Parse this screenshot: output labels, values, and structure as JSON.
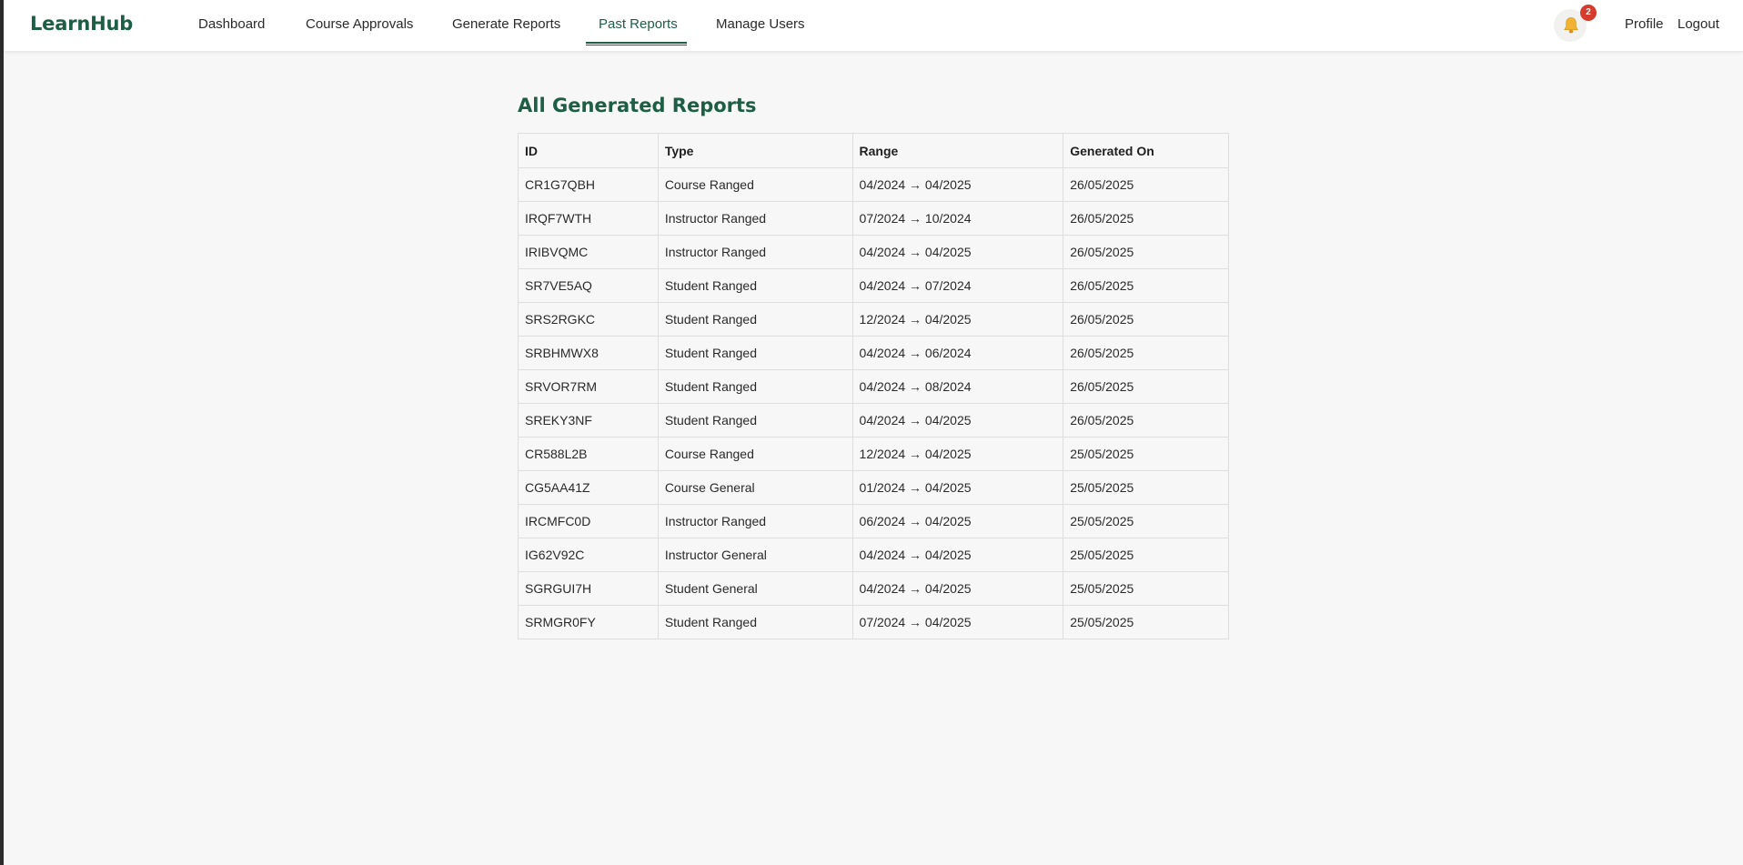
{
  "app": {
    "brand": "LearnHub"
  },
  "nav": {
    "items": [
      {
        "label": "Dashboard"
      },
      {
        "label": "Course Approvals"
      },
      {
        "label": "Generate Reports"
      },
      {
        "label": "Past Reports",
        "active": true
      },
      {
        "label": "Manage Users"
      }
    ],
    "notifications": {
      "icon": "bell-icon",
      "count": "2"
    },
    "profile_label": "Profile",
    "logout_label": "Logout"
  },
  "colors": {
    "brand": "#1e5e45",
    "badge": "#d63c2e",
    "background": "#f7f7f7"
  },
  "page": {
    "title": "All Generated Reports"
  },
  "table": {
    "headers": [
      "ID",
      "Type",
      "Range",
      "Generated On"
    ],
    "rows": [
      [
        "CR1G7QBH",
        "Course Ranged",
        "04/2024 → 04/2025",
        "26/05/2025"
      ],
      [
        "IRQF7WTH",
        "Instructor Ranged",
        "07/2024 → 10/2024",
        "26/05/2025"
      ],
      [
        "IRIBVQMC",
        "Instructor Ranged",
        "04/2024 → 04/2025",
        "26/05/2025"
      ],
      [
        "SR7VE5AQ",
        "Student Ranged",
        "04/2024 → 07/2024",
        "26/05/2025"
      ],
      [
        "SRS2RGKC",
        "Student Ranged",
        "12/2024 → 04/2025",
        "26/05/2025"
      ],
      [
        "SRBHMWX8",
        "Student Ranged",
        "04/2024 → 06/2024",
        "26/05/2025"
      ],
      [
        "SRVOR7RM",
        "Student Ranged",
        "04/2024 → 08/2024",
        "26/05/2025"
      ],
      [
        "SREKY3NF",
        "Student Ranged",
        "04/2024 → 04/2025",
        "26/05/2025"
      ],
      [
        "CR588L2B",
        "Course Ranged",
        "12/2024 → 04/2025",
        "25/05/2025"
      ],
      [
        "CG5AA41Z",
        "Course General",
        "01/2024 → 04/2025",
        "25/05/2025"
      ],
      [
        "IRCMFC0D",
        "Instructor Ranged",
        "06/2024 → 04/2025",
        "25/05/2025"
      ],
      [
        "IG62V92C",
        "Instructor General",
        "04/2024 → 04/2025",
        "25/05/2025"
      ],
      [
        "SGRGUI7H",
        "Student General",
        "04/2024 → 04/2025",
        "25/05/2025"
      ],
      [
        "SRMGR0FY",
        "Student Ranged",
        "07/2024 → 04/2025",
        "25/05/2025"
      ]
    ]
  }
}
